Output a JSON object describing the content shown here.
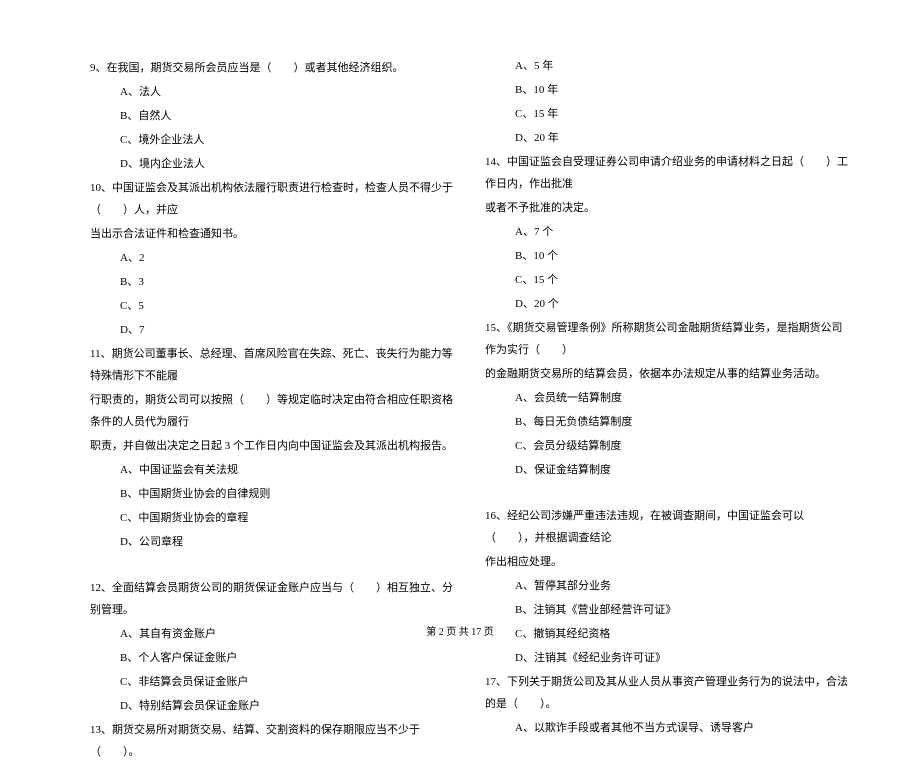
{
  "left_column": {
    "q9": {
      "stem": "9、在我国，期货交易所会员应当是（　　）或者其他经济组织。",
      "options": [
        "A、法人",
        "B、自然人",
        "C、境外企业法人",
        "D、境内企业法人"
      ]
    },
    "q10": {
      "stem_line1": "10、中国证监会及其派出机构依法履行职责进行检查时，检查人员不得少于（　　）人，并应",
      "stem_line2": "当出示合法证件和检查通知书。",
      "options": [
        "A、2",
        "B、3",
        "C、5",
        "D、7"
      ]
    },
    "q11": {
      "stem_line1": "11、期货公司董事长、总经理、首席风险官在失踪、死亡、丧失行为能力等特殊情形下不能履",
      "stem_line2": "行职责的，期货公司可以按照（　　）等规定临时决定由符合相应任职资格条件的人员代为履行",
      "stem_line3": "职责，并自做出决定之日起 3 个工作日内向中国证监会及其派出机构报告。",
      "options": [
        "A、中国证监会有关法规",
        "B、中国期货业协会的自律规则",
        "C、中国期货业协会的章程",
        "D、公司章程"
      ]
    },
    "q12": {
      "stem": "12、全面结算会员期货公司的期货保证金账户应当与（　　）相互独立、分别管理。",
      "options": [
        "A、其自有资金账户",
        "B、个人客户保证金账户",
        "C、非结算会员保证金账户",
        "D、特别结算会员保证金账户"
      ]
    },
    "q13": {
      "stem": "13、期货交易所对期货交易、结算、交割资料的保存期限应当不少于（　　）。"
    }
  },
  "right_column": {
    "q13_options": [
      "A、5 年",
      "B、10 年",
      "C、15 年",
      "D、20 年"
    ],
    "q14": {
      "stem_line1": "14、中国证监会自受理证券公司申请介绍业务的申请材料之日起（　　）工作日内，作出批准",
      "stem_line2": "或者不予批准的决定。",
      "options": [
        "A、7 个",
        "B、10 个",
        "C、15 个",
        "D、20 个"
      ]
    },
    "q15": {
      "stem_line1": "15、《期货交易管理条例》所称期货公司金融期货结算业务，是指期货公司作为实行（　　）",
      "stem_line2": "的金融期货交易所的结算会员，依据本办法规定从事的结算业务活动。",
      "options": [
        "A、会员统一结算制度",
        "B、每日无负债结算制度",
        "C、会员分级结算制度",
        "D、保证金结算制度"
      ]
    },
    "q16": {
      "stem_line1": "16、经纪公司涉嫌严重违法违规，在被调查期间，中国证监会可以（　　），并根据调查结论",
      "stem_line2": "作出相应处理。",
      "options": [
        "A、暂停其部分业务",
        "B、注销其《营业部经营许可证》",
        "C、撤销其经纪资格",
        "D、注销其《经纪业务许可证》"
      ]
    },
    "q17": {
      "stem": "17、下列关于期货公司及其从业人员从事资产管理业务行为的说法中，合法的是（　　）。",
      "options": [
        "A、以欺诈手段或者其他不当方式误导、诱导客户"
      ]
    }
  },
  "footer": "第 2 页 共 17 页"
}
